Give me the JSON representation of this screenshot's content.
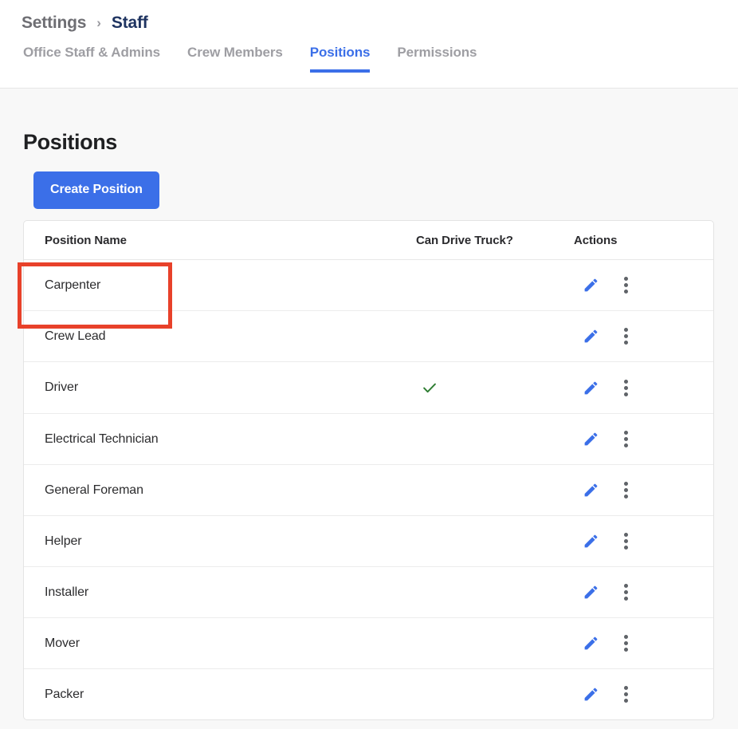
{
  "header": {
    "breadcrumb": {
      "root": "Settings",
      "separator": "›",
      "current": "Staff"
    },
    "tabs": [
      {
        "label": "Office Staff & Admins",
        "active": false
      },
      {
        "label": "Crew Members",
        "active": false
      },
      {
        "label": "Positions",
        "active": true
      },
      {
        "label": "Permissions",
        "active": false
      }
    ]
  },
  "main": {
    "section_title": "Positions",
    "create_button_label": "Create Position",
    "annotation": {
      "kind": "highlight-rectangle",
      "target": "create-position-button",
      "color": "#e8412a"
    }
  },
  "table": {
    "columns": [
      "Position Name",
      "Can Drive Truck?",
      "Actions"
    ],
    "rows": [
      {
        "name": "Carpenter",
        "can_drive_truck": false,
        "edit_icon": "pencil-icon",
        "menu_icon": "more-vertical-icon"
      },
      {
        "name": "Crew Lead",
        "can_drive_truck": false,
        "edit_icon": "pencil-icon",
        "menu_icon": "more-vertical-icon"
      },
      {
        "name": "Driver",
        "can_drive_truck": true,
        "edit_icon": "pencil-icon",
        "menu_icon": "more-vertical-icon"
      },
      {
        "name": "Electrical Technician",
        "can_drive_truck": false,
        "edit_icon": "pencil-icon",
        "menu_icon": "more-vertical-icon"
      },
      {
        "name": "General Foreman",
        "can_drive_truck": false,
        "edit_icon": "pencil-icon",
        "menu_icon": "more-vertical-icon"
      },
      {
        "name": "Helper",
        "can_drive_truck": false,
        "edit_icon": "pencil-icon",
        "menu_icon": "more-vertical-icon"
      },
      {
        "name": "Installer",
        "can_drive_truck": false,
        "edit_icon": "pencil-icon",
        "menu_icon": "more-vertical-icon"
      },
      {
        "name": "Mover",
        "can_drive_truck": false,
        "edit_icon": "pencil-icon",
        "menu_icon": "more-vertical-icon"
      },
      {
        "name": "Packer",
        "can_drive_truck": false,
        "edit_icon": "pencil-icon",
        "menu_icon": "more-vertical-icon"
      }
    ]
  },
  "colors": {
    "accent_blue": "#3b6fe8",
    "breadcrumb_navy": "#1f3461",
    "annotation_red": "#e8412a",
    "check_green": "#2e7d32",
    "inactive_tab_gray": "#9e9ea3",
    "page_background": "#f8f8f8",
    "card_background": "#ffffff"
  }
}
